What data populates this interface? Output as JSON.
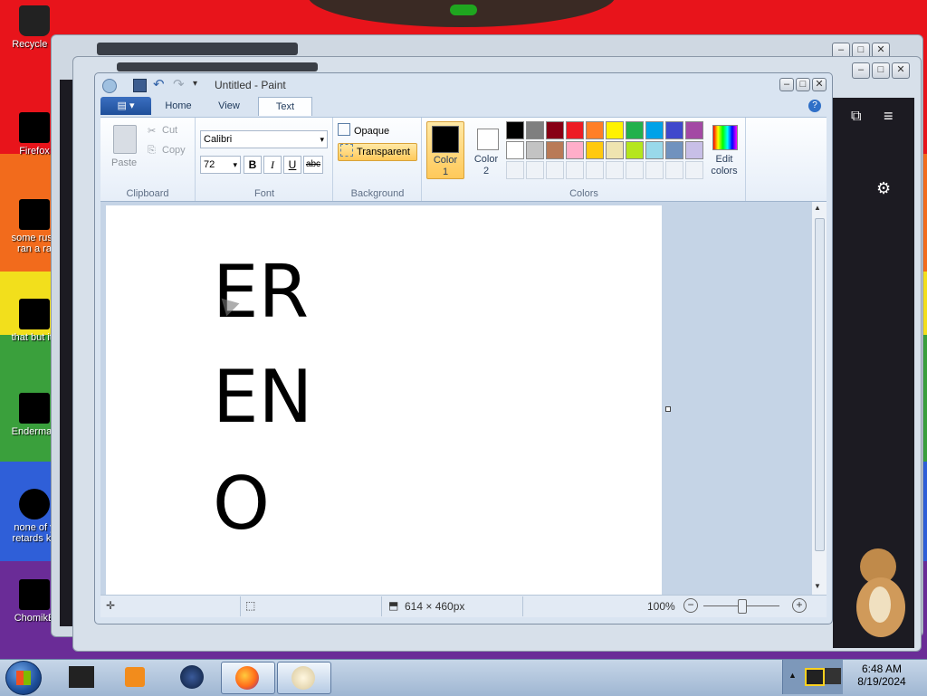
{
  "desktop_icons": [
    {
      "label": "Recycle Bin",
      "shown": "Recycle B"
    },
    {
      "label": "Firefox",
      "shown": "Firefox"
    },
    {
      "label": "some russ... ran a ra",
      "shown": "some russ"
    },
    {
      "label": "ran a ra",
      "shown": "ran a ra"
    },
    {
      "label": "that but its",
      "shown": "that but its"
    },
    {
      "label": "Enderman",
      "shown": "Enderman"
    },
    {
      "label": "none of y retards kn",
      "shown": "none of y"
    },
    {
      "label": "retards kn",
      "shown": "retards kn"
    },
    {
      "label": "ChomikB",
      "shown": "ChomikB"
    }
  ],
  "paint": {
    "title": "Untitled - Paint",
    "tabs": [
      "Home",
      "View",
      "Text"
    ],
    "active_tab": "Text",
    "clipboard": {
      "paste": "Paste",
      "cut": "Cut",
      "copy": "Copy",
      "group": "Clipboard"
    },
    "font": {
      "family": "Calibri",
      "size": "72",
      "bold": "B",
      "italic": "I",
      "underline": "U",
      "strike": "abc",
      "group": "Font"
    },
    "background": {
      "opaque": "Opaque",
      "transparent": "Transparent",
      "group": "Background"
    },
    "colors": {
      "color1_label": "Color 1",
      "color1_line1": "Color",
      "color1_line2": "1",
      "color2_line1": "Color",
      "color2_line2": "2",
      "edit_line1": "Edit",
      "edit_line2": "colors",
      "group": "Colors",
      "color1": "#000000",
      "color2": "#ffffff",
      "palette_row1": [
        "#000000",
        "#7f7f7f",
        "#880015",
        "#ed1c24",
        "#ff7f27",
        "#fff200",
        "#22b14c",
        "#00a2e8",
        "#3f48cc",
        "#a349a4"
      ],
      "palette_row2": [
        "#ffffff",
        "#c3c3c3",
        "#b97a57",
        "#ffaec9",
        "#ffc90e",
        "#efe4b0",
        "#b5e61d",
        "#99d9ea",
        "#7092be",
        "#c8bfe7"
      ]
    },
    "canvas_text": [
      "ER",
      "EN",
      "O"
    ],
    "status": {
      "size": "614 × 460px",
      "zoom": "100%"
    }
  },
  "taskbar": {
    "time": "6:48 AM",
    "date": "8/19/2024"
  }
}
